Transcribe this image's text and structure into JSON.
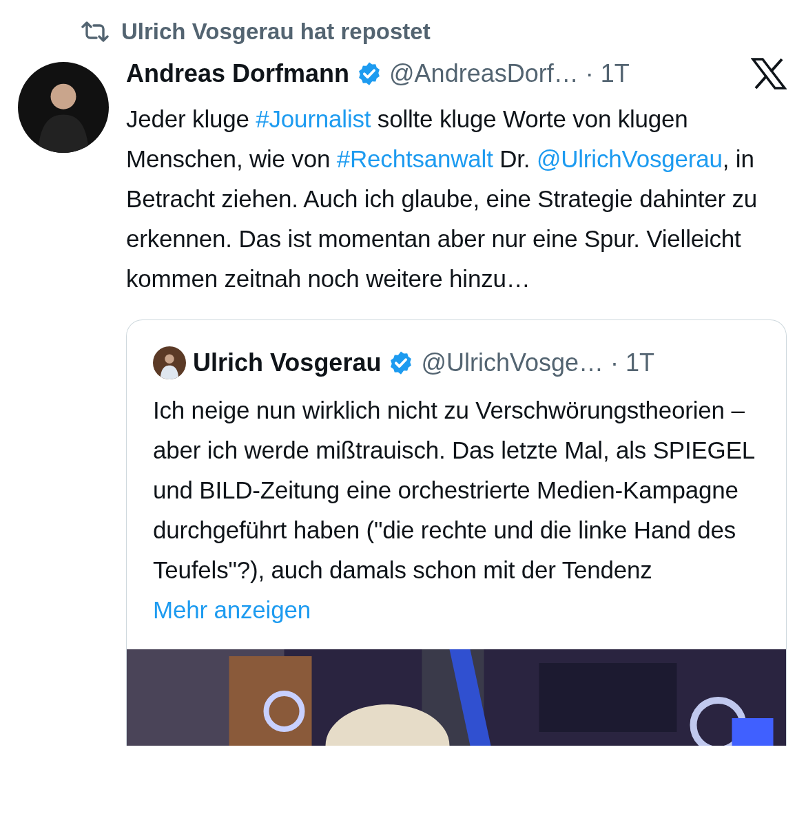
{
  "repost_banner": {
    "text": "Ulrich Vosgerau hat repostet"
  },
  "post": {
    "author": "Andreas Dorfmann",
    "verified": true,
    "handle": "@AndreasDorf…",
    "time": "· 1T",
    "text": [
      {
        "kind": "text",
        "text": "Jeder kluge "
      },
      {
        "kind": "link",
        "text": "#Journalist"
      },
      {
        "kind": "text",
        "text": " sollte kluge Worte von klugen Menschen, wie von "
      },
      {
        "kind": "link",
        "text": "#Rechtsanwalt"
      },
      {
        "kind": "text",
        "text": " Dr. "
      },
      {
        "kind": "link",
        "text": "@UlrichVosgerau"
      },
      {
        "kind": "text",
        "text": ", in Betracht ziehen. Auch ich glaube, eine Strategie dahinter zu erkennen. Das ist momentan aber nur eine Spur. Vielleicht kommen zeitnah noch weitere hinzu…"
      }
    ],
    "quote": {
      "author": "Ulrich Vosgerau",
      "verified": true,
      "handle": "@UlrichVosge…",
      "time": "· 1T",
      "text": "Ich neige nun wirklich nicht zu Verschwörungstheorien – aber ich werde mißtrauisch. Das letzte Mal, als SPIEGEL und BILD-Zeitung eine orchestrierte Medien-Kampagne durchgeführt haben (\"die rechte und die linke Hand des Teufels\"?), auch damals schon mit der Tendenz",
      "more_link": "Mehr anzeigen"
    }
  }
}
